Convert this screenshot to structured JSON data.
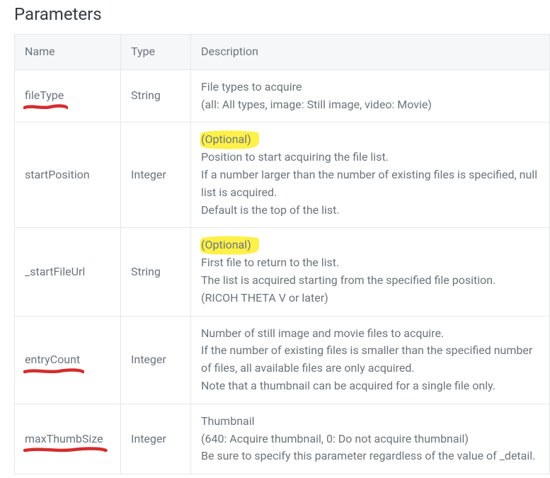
{
  "section_title": "Parameters",
  "table": {
    "headers": {
      "name": "Name",
      "type": "Type",
      "description": "Description"
    },
    "rows": [
      {
        "name": "fileType",
        "type": "String",
        "underline": true,
        "optional": false,
        "desc_lines": [
          "File types to acquire",
          "(all: All types, image: Still image, video: Movie)"
        ]
      },
      {
        "name": "startPosition",
        "type": "Integer",
        "underline": false,
        "optional": true,
        "optional_label": "(Optional)",
        "desc_lines": [
          "Position to start acquiring the file list.",
          "If a number larger than the number of existing files is specified, null list is acquired.",
          "Default is the top of the list."
        ]
      },
      {
        "name": "_startFileUrl",
        "type": "String",
        "underline": false,
        "optional": true,
        "optional_label": "(Optional)",
        "desc_lines": [
          "First file to return to the list.",
          "The list is acquired starting from the specified file position.",
          "(RICOH THETA V or later)"
        ]
      },
      {
        "name": "entryCount",
        "type": "Integer",
        "underline": true,
        "optional": false,
        "desc_lines": [
          "Number of still image and movie files to acquire.",
          "If the number of existing files is smaller than the specified number of files, all available files are only acquired.",
          "Note that a thumbnail can be acquired for a single file only."
        ]
      },
      {
        "name": "maxThumbSize",
        "type": "Integer",
        "underline": true,
        "optional": false,
        "desc_lines": [
          "Thumbnail",
          "(640: Acquire thumbnail, 0: Do not acquire thumbnail)",
          "Be sure to specify this parameter regardless of the value of _detail."
        ]
      }
    ]
  },
  "annotations": {
    "underline_color": "#d62c2c",
    "highlight_color": "#fff04a"
  }
}
